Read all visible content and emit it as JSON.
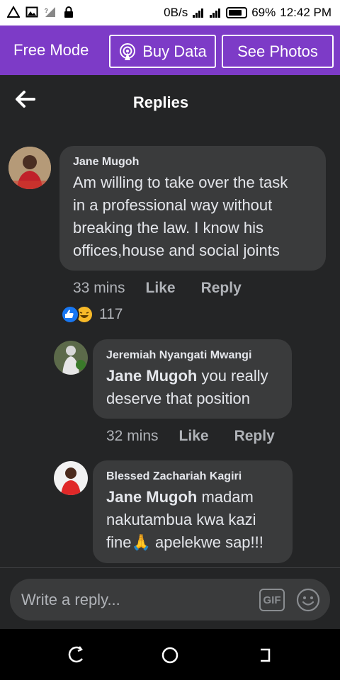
{
  "status_bar": {
    "net_speed": "0B/s",
    "battery": "69%",
    "time": "12:42 PM"
  },
  "free_mode_bar": {
    "label": "Free Mode",
    "buy_data": "Buy Data",
    "see_photos": "See Photos",
    "color": "#7d3bc7"
  },
  "header": {
    "title": "Replies",
    "back_icon": "arrow-left-icon"
  },
  "comments": [
    {
      "author": "Jane Mugoh",
      "text_lines": [
        "Am willing to take over the task",
        "in a professional  way without",
        "breaking  the law.  I know his",
        "offices,house and social  joints"
      ],
      "time": "33 mins",
      "like": "Like",
      "reply": "Reply",
      "reactions": {
        "icons": [
          "like-reaction-icon",
          "haha-reaction-icon"
        ],
        "count": "117"
      }
    }
  ],
  "replies": [
    {
      "author": "Jeremiah Nyangati Mwangi",
      "mention": "Jane Mugoh",
      "text_line1_rest": " you really",
      "text_line2": "deserve that position",
      "time": "32 mins",
      "like": "Like",
      "reply": "Reply"
    },
    {
      "author": "Blessed Zachariah Kagiri",
      "mention": "Jane Mugoh",
      "text_line1_rest": " madam",
      "text_line2": "nakutambua kwa kazi",
      "text_line3_pre": "fine",
      "text_line3_emoji": "🙏",
      "text_line3_post": " apelekwe sap!!!"
    }
  ],
  "composer": {
    "placeholder": "Write a reply...",
    "gif_label": "GIF"
  }
}
